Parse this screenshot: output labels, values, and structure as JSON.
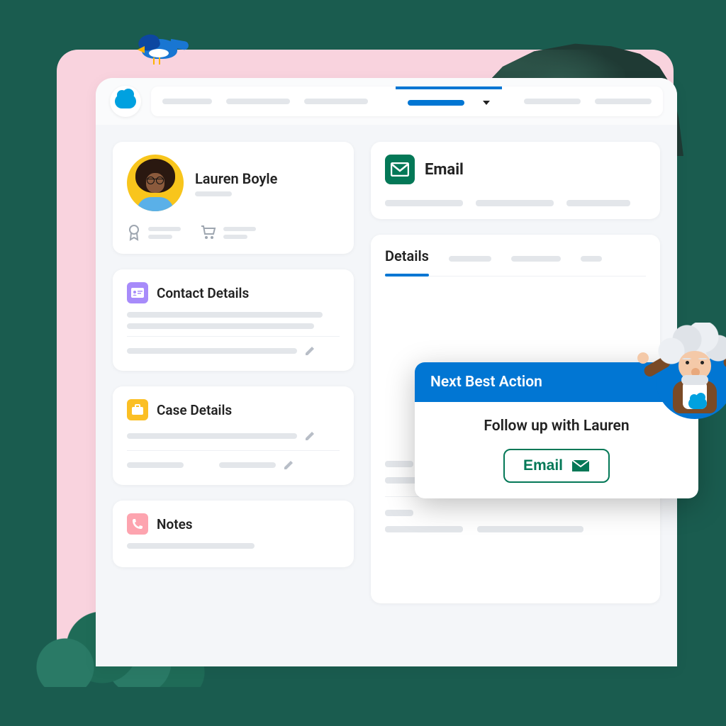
{
  "profile": {
    "name": "Lauren Boyle"
  },
  "sections": {
    "contact": {
      "title": "Contact Details",
      "icon": "id-card-icon",
      "color": "#a78bfa"
    },
    "case": {
      "title": "Case Details",
      "icon": "briefcase-icon",
      "color": "#fbbf24"
    },
    "notes": {
      "title": "Notes",
      "icon": "phone-icon",
      "color": "#fda4af"
    }
  },
  "email_panel": {
    "title": "Email"
  },
  "details_panel": {
    "tab_active": "Details"
  },
  "next_best_action": {
    "header": "Next Best Action",
    "message": "Follow up with Lauren",
    "button_label": "Email"
  },
  "colors": {
    "primary": "#0176d3",
    "green": "#047857",
    "sf_cloud": "#00a1e0"
  }
}
